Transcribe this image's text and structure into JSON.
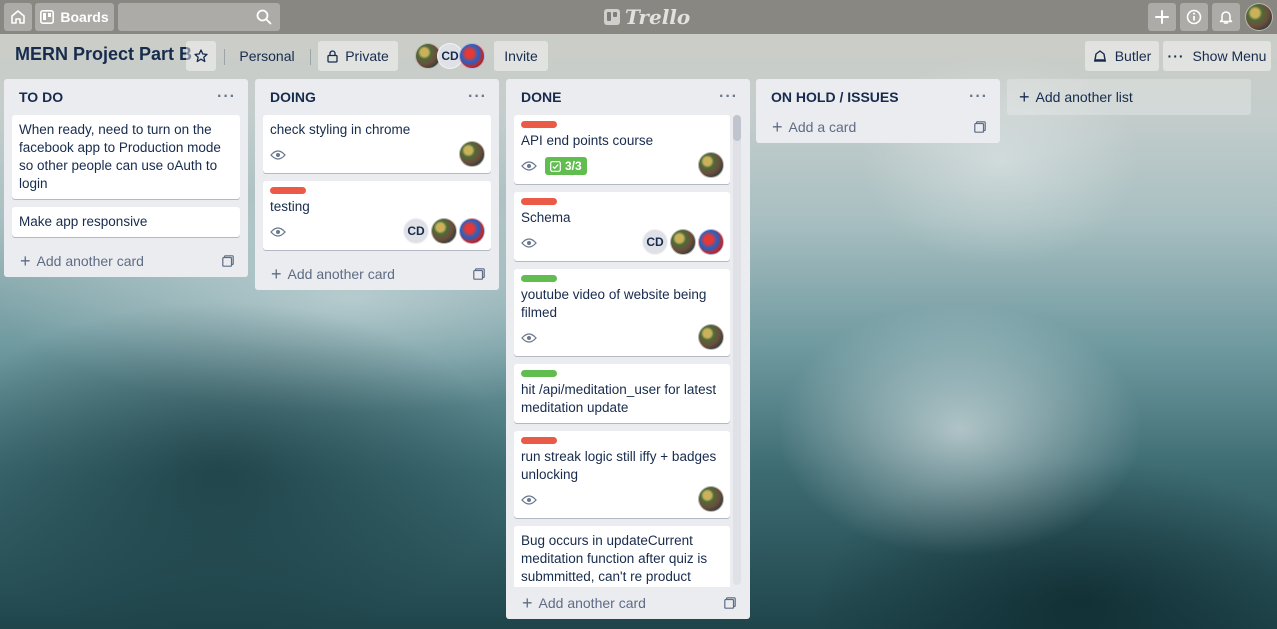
{
  "topbar": {
    "boards_label": "Boards",
    "search_placeholder": "",
    "logo_text": "Trello"
  },
  "board": {
    "title": "MERN Project Part B",
    "team": "Personal",
    "visibility": "Private",
    "invite_label": "Invite",
    "butler_label": "Butler",
    "show_menu_label": "Show Menu",
    "member_initials": "CD"
  },
  "lists": [
    {
      "title": "TO DO",
      "add_label": "Add another card",
      "cards": [
        {
          "text": "When ready, need to turn on the facebook app to Production mode so other people can use oAuth to login"
        },
        {
          "text": "Make app responsive"
        }
      ]
    },
    {
      "title": "DOING",
      "add_label": "Add another card",
      "cards": [
        {
          "text": "check styling in chrome",
          "initials": ""
        },
        {
          "text": "testing",
          "initials": "CD"
        }
      ]
    },
    {
      "title": "DONE",
      "add_label": "Add another card",
      "cards": [
        {
          "text": "API end points course",
          "checklist": "3/3"
        },
        {
          "text": "Schema",
          "initials": "CD"
        },
        {
          "text": "youtube video of website being filmed"
        },
        {
          "text": "hit /api/meditation_user for latest meditation update"
        },
        {
          "text": "run streak logic still iffy + badges unlocking"
        },
        {
          "text": "Bug occurs in updateCurrent meditation function after quiz is submmitted, can't re product error consistenly"
        }
      ]
    },
    {
      "title": "ON HOLD / ISSUES",
      "add_label": "Add a card",
      "cards": []
    }
  ],
  "add_list_label": "Add another list",
  "colors": {
    "label_red": "#eb5a46",
    "label_green": "#61bd4f",
    "list_bg": "#ebecf0"
  }
}
